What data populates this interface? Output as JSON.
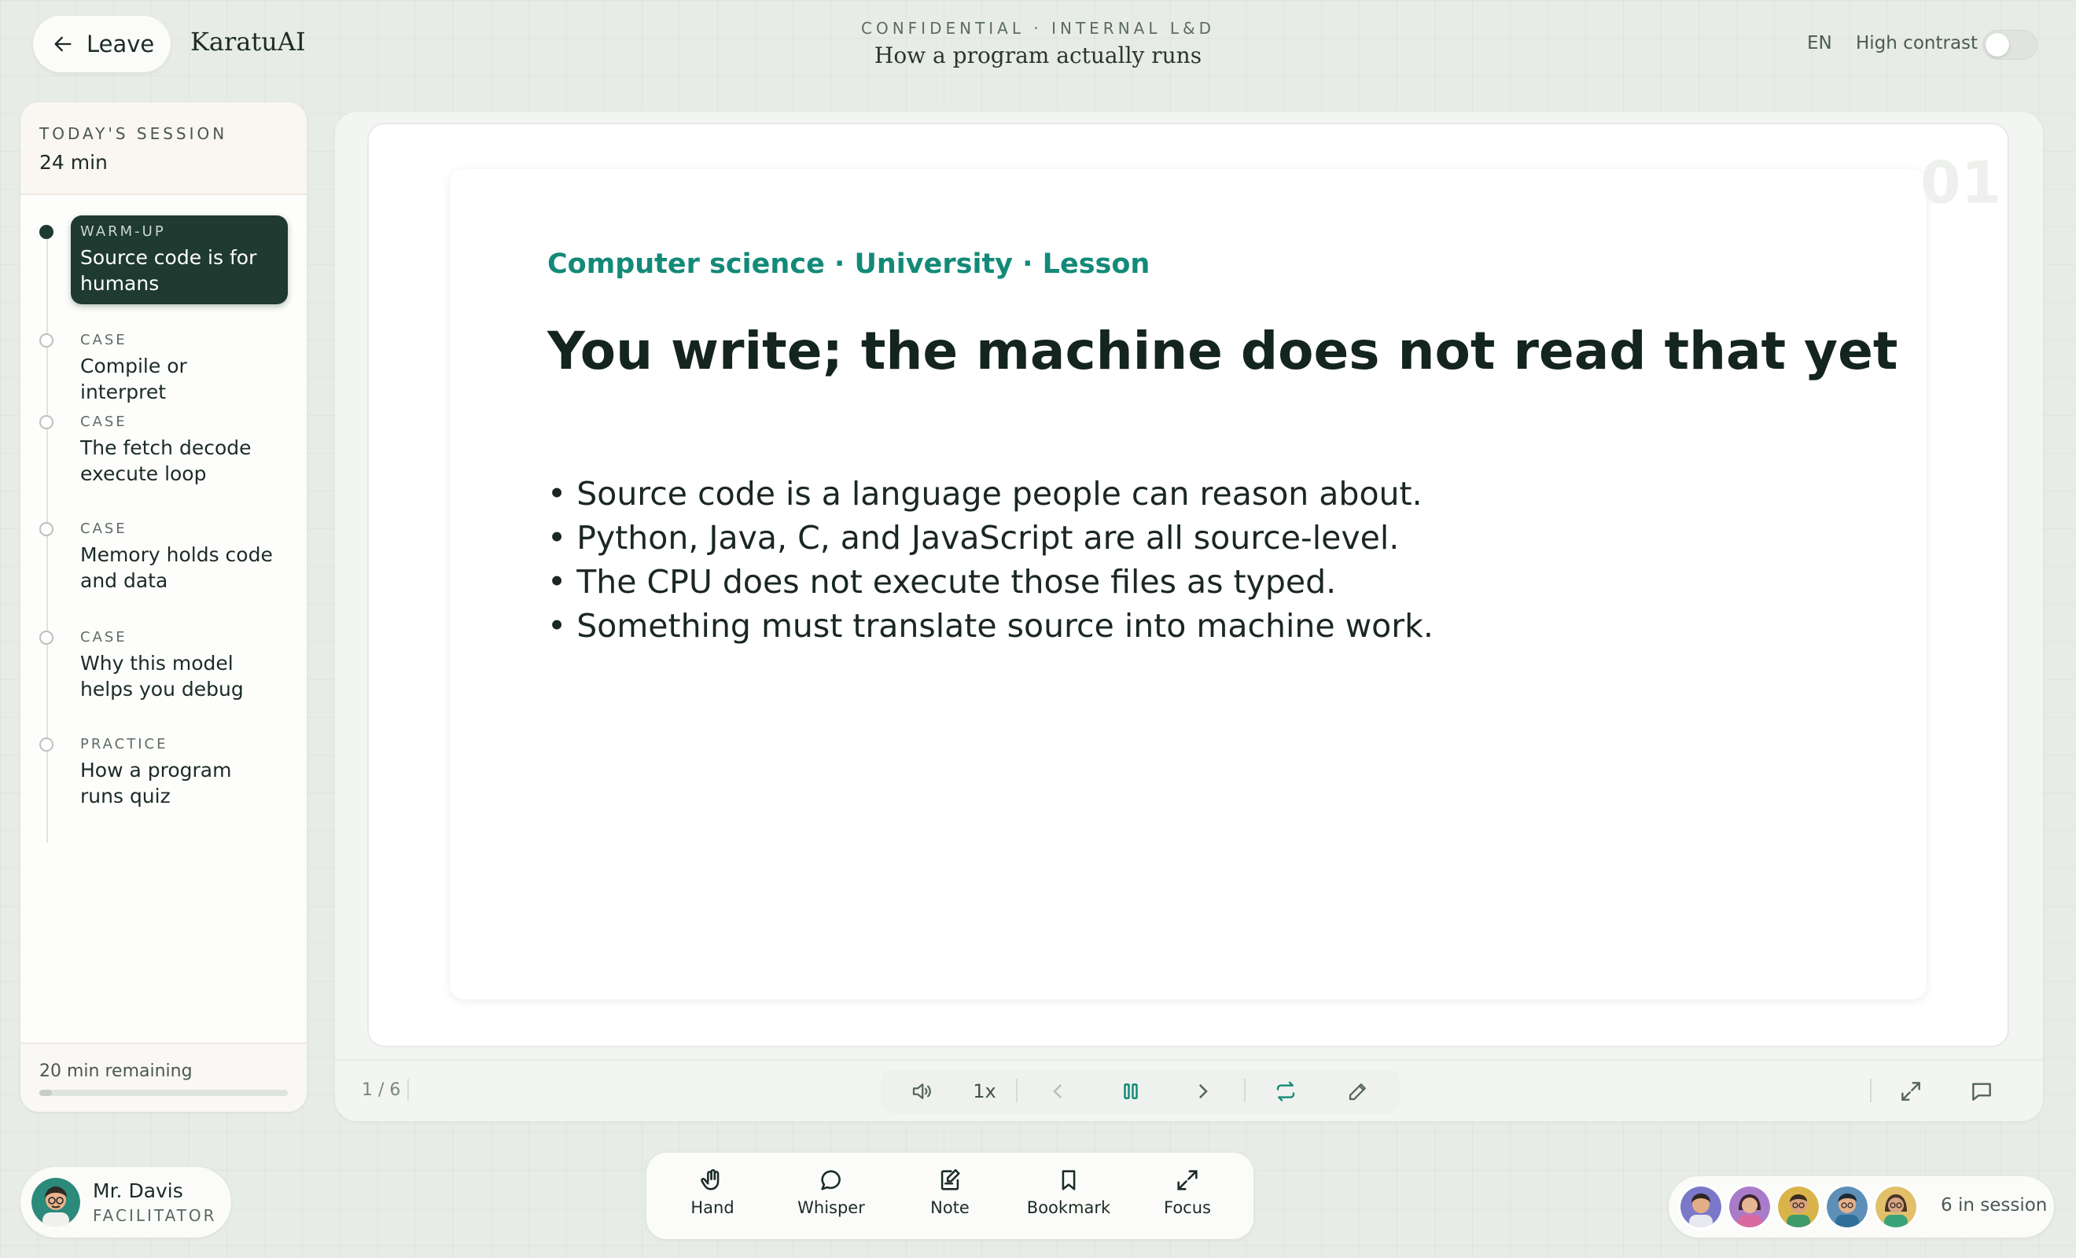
{
  "header": {
    "leave_label": "Leave",
    "brand": "KaratuAI",
    "confidential": "CONFIDENTIAL · INTERNAL L&D",
    "doc_title": "How a program actually runs",
    "language": "EN",
    "contrast_label": "High contrast",
    "contrast_on": false
  },
  "sidebar": {
    "label": "TODAY'S SESSION",
    "duration": "24 min",
    "steps": [
      {
        "kind": "WARM-UP",
        "title": "Source code is for humans",
        "active": true
      },
      {
        "kind": "CASE",
        "title": "Compile or interpret",
        "active": false
      },
      {
        "kind": "CASE",
        "title": "The fetch decode execute loop",
        "active": false
      },
      {
        "kind": "CASE",
        "title": "Memory holds code and data",
        "active": false
      },
      {
        "kind": "CASE",
        "title": "Why this model helps you debug",
        "active": false
      },
      {
        "kind": "PRACTICE",
        "title": "How a program runs quiz",
        "active": false
      }
    ],
    "remaining": "20 min remaining",
    "remaining_fraction": 0.05
  },
  "slide": {
    "number": "01",
    "breadcrumb": "Computer science · University · Lesson",
    "title": "You write; the machine does not read that yet",
    "bullets": [
      "• Source code is a language people can reason about.",
      "• Python, Java, C, and JavaScript are all source-level.",
      "• The CPU does not execute those files as typed.",
      "• Something must translate source into machine work."
    ]
  },
  "player": {
    "pager": "1 / 6",
    "speed": "1x",
    "icons": [
      "volume-icon",
      "prev-icon",
      "pause-icon",
      "next-icon",
      "loop-icon",
      "pen-icon",
      "fullscreen-icon",
      "captions-icon"
    ]
  },
  "host": {
    "name": "Mr. Davis",
    "role": "FACILITATOR"
  },
  "actions": [
    {
      "label": "Hand",
      "icon": "hand-icon"
    },
    {
      "label": "Whisper",
      "icon": "whisper-icon"
    },
    {
      "label": "Note",
      "icon": "note-icon"
    },
    {
      "label": "Bookmark",
      "icon": "bookmark-icon"
    },
    {
      "label": "Focus",
      "icon": "focus-icon"
    }
  ],
  "session": {
    "count_label": "6 in session"
  },
  "colors": {
    "accent": "#138a78",
    "dark": "#1f3a30"
  }
}
